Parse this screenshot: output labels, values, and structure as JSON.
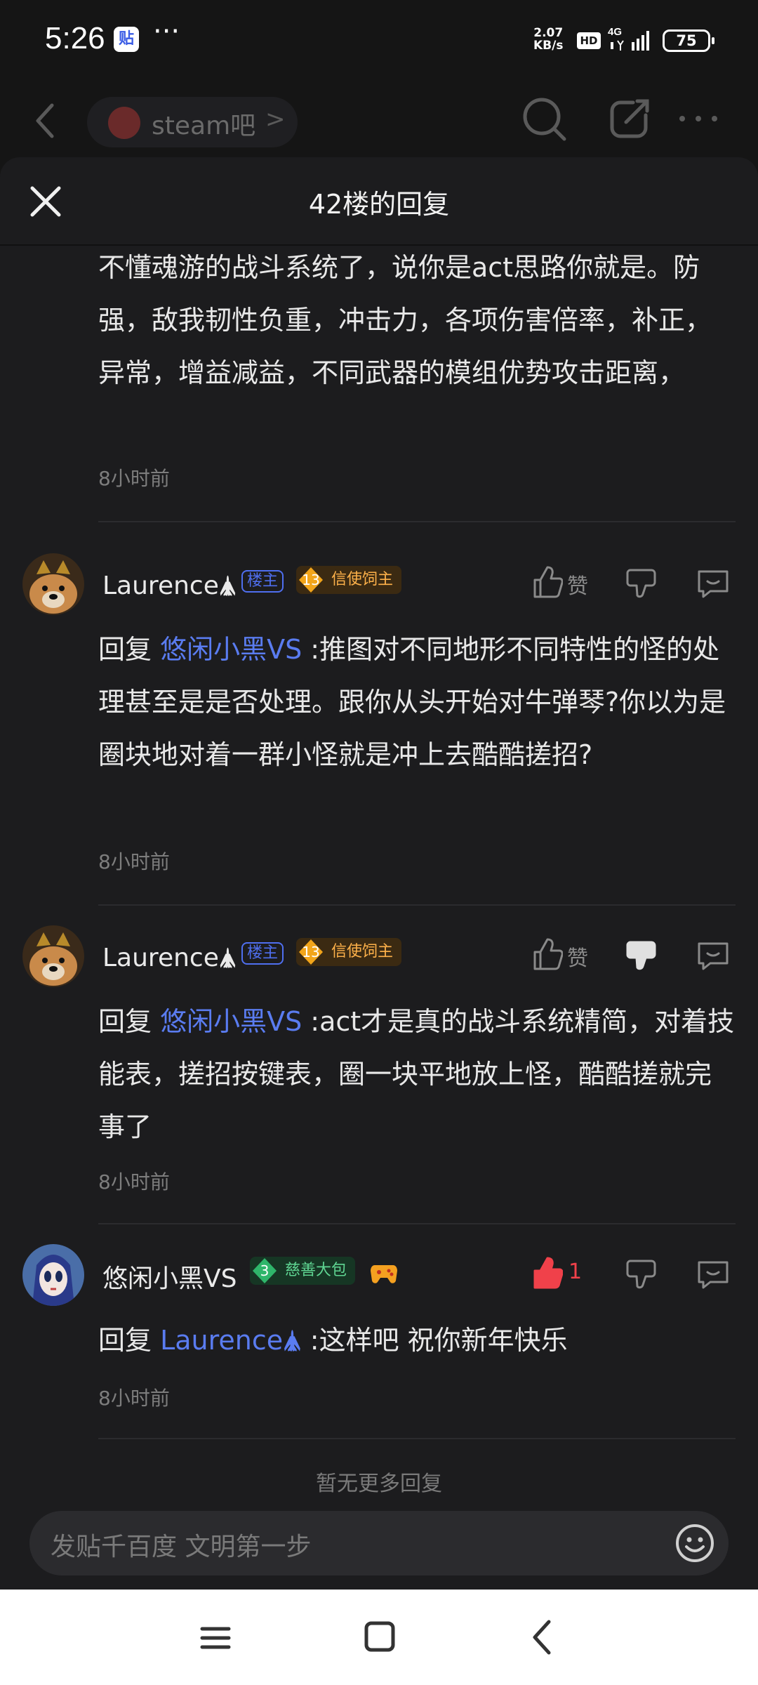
{
  "status_bar": {
    "time": "5:26",
    "app_badge": "贴",
    "more": "···",
    "net_speed_value": "2.07",
    "net_speed_unit": "KB/s",
    "hd": "HD",
    "network": "4G",
    "battery": "75"
  },
  "nav": {
    "forum_name": "steam吧",
    "chevron": ">"
  },
  "sheet": {
    "title": "42楼的回复"
  },
  "first_post": {
    "text": "不懂魂游的战斗系统了，说你是act思路你就是。防强，敌我韧性负重，冲击力，各项伤害倍率，补正，异常，增益减益，不同武器的模组优势攻击距离，",
    "time": "8小时前"
  },
  "replies": [
    {
      "user": "Laurence🛦",
      "lz_badge": "楼主",
      "level": "13",
      "level_title": "信使饲主",
      "like_label": "赞",
      "reply_prefix": "回复 ",
      "mention": "悠闲小黑VS",
      "text": " :推图对不同地形不同特性的怪的处理甚至是是否处理。跟你从头开始对牛弹琴?你以为是圈块地对着一群小怪就是冲上去酷酷搓招?",
      "time": "8小时前"
    },
    {
      "user": "Laurence🛦",
      "lz_badge": "楼主",
      "level": "13",
      "level_title": "信使饲主",
      "like_label": "赞",
      "reply_prefix": "回复 ",
      "mention": "悠闲小黑VS",
      "text": " :act才是真的战斗系统精简，对着技能表，搓招按键表，圈一块平地放上怪，酷酷搓就完事了",
      "time": "8小时前"
    },
    {
      "user": "悠闲小黑VS",
      "level": "3",
      "level_title": "慈善大包",
      "like_count": "1",
      "reply_prefix": "回复 ",
      "mention": "Laurence🛦",
      "text": " :这样吧 祝你新年快乐",
      "time": "8小时前"
    }
  ],
  "no_more": "暂无更多回复",
  "input": {
    "placeholder": "发贴千百度 文明第一步"
  },
  "colors": {
    "background": "#151515",
    "sheet": "#1c1c1e",
    "mention": "#5a7cf0",
    "like_active": "#f0414a",
    "level_gold": "#ffb24a",
    "level_green": "#5fd592"
  },
  "icons": [
    "back-icon",
    "search-icon",
    "share-icon",
    "more-icon",
    "close-icon",
    "thumbs-up-icon",
    "thumbs-down-icon",
    "comment-icon",
    "emoji-icon",
    "game-controller-icon",
    "menu-icon",
    "home-icon",
    "nav-back-icon"
  ]
}
